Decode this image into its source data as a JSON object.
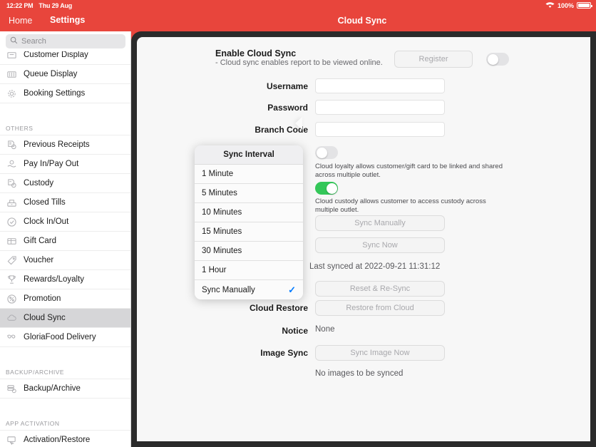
{
  "statusbar": {
    "time": "12:22 PM",
    "date": "Thu 29 Aug",
    "battery_percent": "100%",
    "wifi_icon": "wifi-icon",
    "battery_icon": "battery-full-icon"
  },
  "navbar": {
    "home": "Home",
    "settings": "Settings",
    "title": "Cloud Sync"
  },
  "sidebar": {
    "search_placeholder": "Search",
    "search_icon": "search-icon",
    "items": [
      {
        "label": "Customer Display",
        "icon": "customer-display-icon",
        "selected": false,
        "clipped": true
      },
      {
        "label": "Queue Display",
        "icon": "queue-display-icon",
        "selected": false
      },
      {
        "label": "Booking Settings",
        "icon": "gear-icon",
        "selected": false
      }
    ],
    "sections": [
      {
        "title": "OTHERS",
        "items": [
          {
            "label": "Previous Receipts",
            "icon": "receipt-icon",
            "selected": false
          },
          {
            "label": "Pay In/Pay Out",
            "icon": "cash-hand-icon",
            "selected": false
          },
          {
            "label": "Custody",
            "icon": "custody-icon",
            "selected": false
          },
          {
            "label": "Closed Tills",
            "icon": "till-icon",
            "selected": false
          },
          {
            "label": "Clock In/Out",
            "icon": "clock-icon",
            "selected": false
          },
          {
            "label": "Gift Card",
            "icon": "gift-card-icon",
            "selected": false
          },
          {
            "label": "Voucher",
            "icon": "tag-icon",
            "selected": false
          },
          {
            "label": "Rewards/Loyalty",
            "icon": "trophy-icon",
            "selected": false
          },
          {
            "label": "Promotion",
            "icon": "percent-icon",
            "selected": false
          },
          {
            "label": "Cloud Sync",
            "icon": "cloud-icon",
            "selected": true
          },
          {
            "label": "GloriaFood Delivery",
            "icon": "delivery-icon",
            "selected": false
          }
        ]
      },
      {
        "title": "BACKUP/ARCHIVE",
        "items": [
          {
            "label": "Backup/Archive",
            "icon": "backup-icon",
            "selected": false
          }
        ]
      },
      {
        "title": "APP ACTIVATION",
        "items": [
          {
            "label": "Activation/Restore",
            "icon": "activation-icon",
            "selected": false
          }
        ]
      }
    ]
  },
  "main": {
    "enable_title": "Enable Cloud Sync",
    "enable_subtitle": "- Cloud sync enables report to be viewed online.",
    "register_button": "Register",
    "enable_toggle_on": false,
    "username_label": "Username",
    "username_value": "",
    "password_label": "Password",
    "password_value": "",
    "branch_code_label": "Branch Code",
    "branch_code_value": "",
    "loyalty_toggle_on": false,
    "loyalty_hint": "Cloud loyalty allows customer/gift card to be linked and shared across multiple outlet.",
    "custody_toggle_on": true,
    "custody_hint": "Cloud custody allows customer to access custody across multiple outlet.",
    "sync_manually_button": "Sync Manually",
    "sync_now_button": "Sync Now",
    "last_synced": "Last synced at 2022-09-21 11:31:12",
    "reset_resync_button": "Reset & Re-Sync",
    "cloud_restore_label": "Cloud Restore",
    "restore_button": "Restore from Cloud",
    "notice_label": "Notice",
    "notice_value": "None",
    "image_sync_label": "Image Sync",
    "sync_image_button": "Sync Image Now",
    "no_images_text": "No images to be synced"
  },
  "popover": {
    "title": "Sync Interval",
    "options": [
      {
        "label": "1 Minute",
        "checked": false
      },
      {
        "label": "5 Minutes",
        "checked": false
      },
      {
        "label": "10 Minutes",
        "checked": false
      },
      {
        "label": "15 Minutes",
        "checked": false
      },
      {
        "label": "30 Minutes",
        "checked": false
      },
      {
        "label": "1 Hour",
        "checked": false
      },
      {
        "label": "Sync Manually",
        "checked": true
      }
    ],
    "check_glyph": "✓",
    "accent_color": "#007aff"
  },
  "colors": {
    "brand": "#e8453c",
    "toggle_on": "#34c759",
    "selected_row": "#d6d6d8"
  }
}
